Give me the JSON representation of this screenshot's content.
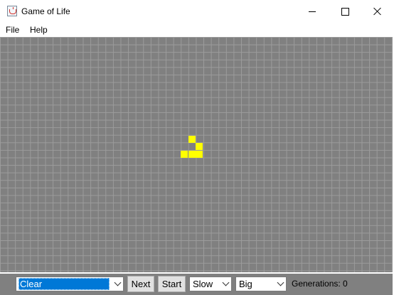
{
  "window": {
    "title": "Game of Life"
  },
  "menu": {
    "items": [
      "File",
      "Help"
    ]
  },
  "board": {
    "cell_color": "#ffff00",
    "grid_color": "#9c9c9c",
    "background_color": "#808080",
    "live_cells": [
      {
        "row": 13,
        "col": 25
      },
      {
        "row": 14,
        "col": 26
      },
      {
        "row": 15,
        "col": 24
      },
      {
        "row": 15,
        "col": 25
      },
      {
        "row": 15,
        "col": 26
      }
    ]
  },
  "controls": {
    "action_select": {
      "value": "Clear"
    },
    "next_label": "Next",
    "start_label": "Start",
    "speed_select": {
      "value": "Slow"
    },
    "size_select": {
      "value": "Big"
    },
    "generations_label": "Generations: 0"
  }
}
